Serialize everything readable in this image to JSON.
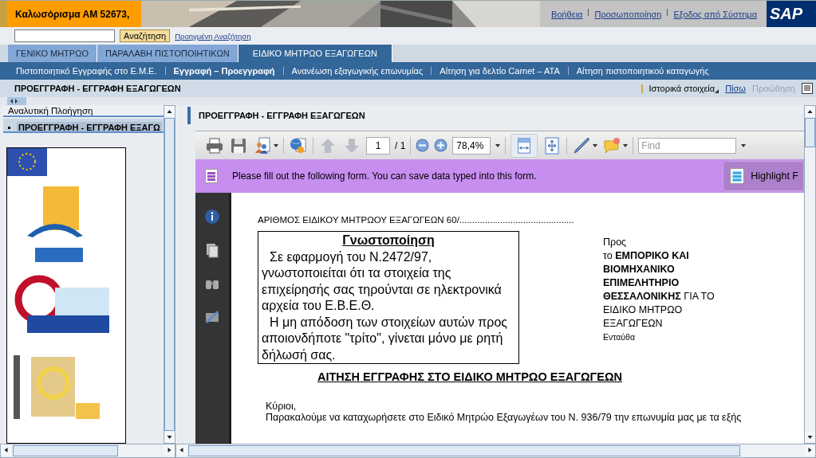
{
  "header": {
    "welcome": "Καλωσόρισμα ΑΜ 52673,",
    "links": [
      "Βοήθεια",
      "Προσωποποίηση",
      "Εξοδος από Σύστημα"
    ],
    "logo": "SAP"
  },
  "search": {
    "button": "Αναζήτηση",
    "advanced_link": "Προηγμένη Αναζήτηση"
  },
  "tabs": [
    {
      "label": "ΓΕΝΙΚΟ ΜΗΤΡΩΟ",
      "selected": false
    },
    {
      "label": "ΠΑΡΑΛΑΒΗ ΠΙΣΤΟΠΟΙΗΤΙΚΩΝ",
      "selected": false
    },
    {
      "label": "ΕΙΔΙΚΟ ΜΗΤΡΩΟ ΕΞΑΓΩΓΕΩΝ",
      "selected": true
    }
  ],
  "subnav": [
    {
      "label": "Πιστοποιητικό Εγγραφής στο Ε.Μ.Ε.",
      "selected": false
    },
    {
      "label": "Εγγραφή – Προεγγραφή",
      "selected": true
    },
    {
      "label": "Ανανέωση εξαγωγικής επωνυμίας",
      "selected": false
    },
    {
      "label": "Αίτηση για δελτίο Carnet – ATA",
      "selected": false
    },
    {
      "label": "Αίτηση πιστοποιητικού καταγωγής",
      "selected": false
    }
  ],
  "page_title": "ΠΡΟΕΓΓΡΑΦΗ - ΕΓΓΡΑΦΗ ΕΞΑΓΩΓΕΩΝ",
  "page_actions": [
    {
      "label": "Ιστορικά στοιχεία",
      "kind": "menu"
    },
    {
      "label": "Πίσω",
      "kind": "link"
    },
    {
      "label": "Προώθηση",
      "kind": "disabled"
    }
  ],
  "sidebar": {
    "title": "Αναλυτική Πλοήγηση",
    "items": [
      {
        "label": "ΠΡΟΕΓΓΡΑΦΗ - ΕΓΓΡΑΦΗ ΕΞΑΓΩ",
        "selected": true
      }
    ]
  },
  "content_title": "ΠΡΟΕΓΓΡΑΦΗ - ΕΓΓΡΑΦΗ ΕΞΑΓΩΓΕΩΝ",
  "pdf": {
    "page": "1",
    "page_count": "/ 1",
    "zoom": "78,4%",
    "find_placeholder": "Find",
    "form_notice": "Please fill out the following form. You can save data typed into this form.",
    "highlight_button": "Highlight F",
    "document": {
      "number_line": "ΑΡΙΘΜΟΣ ΕΙΔΙΚΟΥ ΜΗΤΡΩΟΥ ΕΞΑΓΩΓΕΩΝ 60/.............................................",
      "notice_title": "Γνωστοποίηση",
      "notice_paragraphs": [
        "Σε εφαρμογή του Ν.2472/97, γνωστοποιείται ότι τα στοιχεία της επιχείρησής σας τηρούνται σε ηλεκτρονικά αρχεία του Ε.Β.Ε.Θ.",
        "Η μη απόδοση των στοιχείων αυτών προς αποιονδήποτε \"τρίτο\", γίνεται μόνο με ρητή δήλωσή σας."
      ],
      "recipient_label": "Προς",
      "recipient": "το **ΕΜΠΟΡΙΚΟ ΚΑΙ ΒΙΟΜΗΧΑΝΙΚΟ ΕΠΙΜΕΛΗΤΗΡΙΟ ΘΕΣΣΑΛΟΝΙΚΗΣ** ΓΙΑ ΤΟ ΕΙΔΙΚΟ ΜΗΤΡΩΟ ΕΞΑΓΩΓΕΩΝ",
      "recipient_place": "Ενταύθα",
      "heading": "ΑΙΤΗΣΗ ΕΓΓΡΑΦΗΣ ΣΤΟ ΕΙΔΙΚΟ ΜΗΤΡΩΟ ΕΞΑΓΩΓΕΩΝ",
      "salutation": "Κύριοι,",
      "body": "Παρακαλούμε να καταχωρήσετε στο Ειδικό Μητρώο Εξαγωγέων του Ν. 936/79 την επωνυμία μας με τα εξής"
    }
  }
}
